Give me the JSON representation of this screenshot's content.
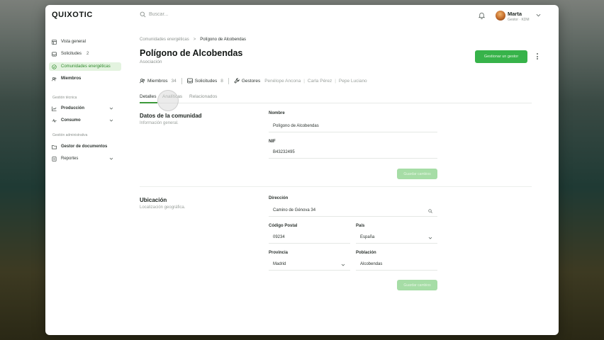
{
  "app": {
    "logo": "QUIXOTIC"
  },
  "search": {
    "placeholder": "Buscar..."
  },
  "user": {
    "name": "Marta",
    "role": "Gestor · KDM"
  },
  "sidebar": {
    "items": [
      {
        "label": "Vista general",
        "icon": "dashboard-icon"
      },
      {
        "label": "Solicitudes",
        "count": "2",
        "icon": "inbox-icon"
      },
      {
        "label": "Comunidades energéticas",
        "icon": "community-icon",
        "active": true
      },
      {
        "label": "Miembros",
        "icon": "users-icon"
      }
    ],
    "section_tech": "Gestión técnica",
    "tech_items": [
      {
        "label": "Producción",
        "icon": "chart-line-icon"
      },
      {
        "label": "Consumo",
        "icon": "activity-icon"
      }
    ],
    "section_admin": "Gestión administrativa",
    "admin_items": [
      {
        "label": "Gestor de documentos",
        "icon": "folder-icon"
      },
      {
        "label": "Reportes",
        "icon": "report-icon"
      }
    ]
  },
  "breadcrumb": {
    "parent": "Comunidades energéticas",
    "separator": ">",
    "current": "Polígono de Alcobendas"
  },
  "page": {
    "title": "Polígono de Alcobendas",
    "subtitle": "Asociación",
    "primary_button": "Gestionar un gestor"
  },
  "meta": {
    "members_label": "Miembros",
    "members_count": "34",
    "requests_label": "Solicitudes",
    "requests_count": "8",
    "managers_label": "Gestores",
    "managers": [
      "Penélope Ancona",
      "Carla Pérez",
      "Pepe Luciano"
    ]
  },
  "tabs": [
    "Detalles",
    "Analíticas",
    "Relacionados"
  ],
  "community": {
    "section_title": "Datos de la comunidad",
    "section_subtitle": "Información general.",
    "name_label": "Nombre",
    "name_value": "Polígono de Alcobendas",
    "nif_label": "NIF",
    "nif_value": "B43232495",
    "save_label": "Guardar cambios"
  },
  "location": {
    "section_title": "Ubicación",
    "section_subtitle": "Localización geográfica.",
    "address_label": "Dirección",
    "address_value": "Camino de Génova 34",
    "postal_label": "Código Postal",
    "postal_value": "09234",
    "country_label": "País",
    "country_value": "España",
    "province_label": "Provincia",
    "province_value": "Madrid",
    "town_label": "Población",
    "town_value": "Alcobendas",
    "save_label": "Guardar cambios"
  },
  "colors": {
    "accent": "#37b34a",
    "active_bg": "#e3f3df",
    "disabled_btn": "#a6dda6"
  }
}
